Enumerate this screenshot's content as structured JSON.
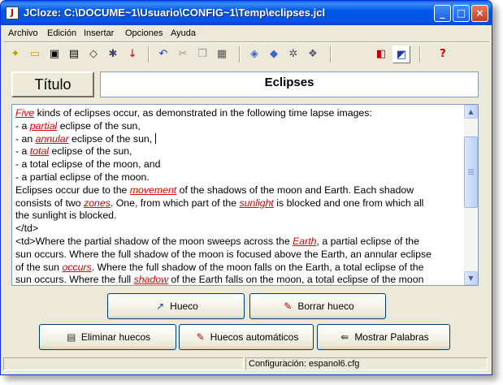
{
  "window": {
    "title": "JCloze: C:\\DOCUME~1\\Usuario\\CONFIG~1\\Temp\\eclipses.jcl",
    "minimize": "_",
    "maximize": "□",
    "close": "×"
  },
  "menu": [
    "Archivo",
    "Edición",
    "Insertar",
    "Opciones",
    "Ayuda"
  ],
  "toolbar": {
    "icons": [
      "new-icon",
      "open-icon",
      "save-icon",
      "save-as-icon",
      "eraser-icon",
      "settings-icon",
      "down-arrow-icon",
      "undo-icon",
      "cut-icon",
      "copy-icon",
      "paste-icon",
      "web-export-icon",
      "hot-potatoes-icon",
      "config-icon",
      "gap-icon",
      "color-icon",
      "view-icon",
      "help-icon"
    ],
    "help_glyph": "?"
  },
  "title_section": {
    "label": "Título",
    "value": "Eclipses"
  },
  "text": {
    "l1a": "Five",
    "l1b": " kinds of eclipses occur, as demonstrated in the following time lapse images:",
    "l2a": "- a ",
    "l2b": "partial",
    "l2c": " eclipse of the sun,",
    "l3a": "- an ",
    "l3b": "annular",
    "l3c": " eclipse of the sun,",
    "l4a": "- a ",
    "l4b": "total",
    "l4c": " eclipse of the sun,",
    "l5": "- a total eclipse of the moon, and",
    "l6": "- a partial eclipse of the moon.",
    "l7a": "Eclipses occur due to the ",
    "l7b": "movement",
    "l7c": " of the shadows of the moon and Earth. Each shadow",
    "l8a": "consists of two ",
    "l8b": "zones",
    "l8c": ". One, from which part of the ",
    "l8d": "sunlight",
    "l8e": " is blocked and one from which all",
    "l9": "the sunlight is blocked.",
    "l10": "</td>",
    "l11a": "<td>Where the partial shadow of the moon sweeps across the ",
    "l11b": "Earth",
    "l11c": ", a partial eclipse of the",
    "l12": "sun occurs. Where the full shadow of the moon is focused above the Earth, an annular eclipse",
    "l13a": "of the sun ",
    "l13b": "occurs",
    "l13c": ". Where the full shadow of the moon falls on the Earth, a total eclipse of the",
    "l14a": "sun occurs. Where the full ",
    "l14b": "shadow",
    "l14c": " of the Earth falls on the moon, a total eclipse of the moon"
  },
  "buttons": {
    "hueco": "Hueco",
    "borrar_hueco": "Borrar hueco",
    "eliminar_huecos": "Eliminar huecos",
    "huecos_automaticos": "Huecos automáticos",
    "mostrar_palabras": "Mostrar Palabras"
  },
  "status": {
    "config": "Configuración: espanol6.cfg"
  },
  "colors": {
    "gap_text": "#e00000",
    "titlebar": "#0054e3"
  }
}
